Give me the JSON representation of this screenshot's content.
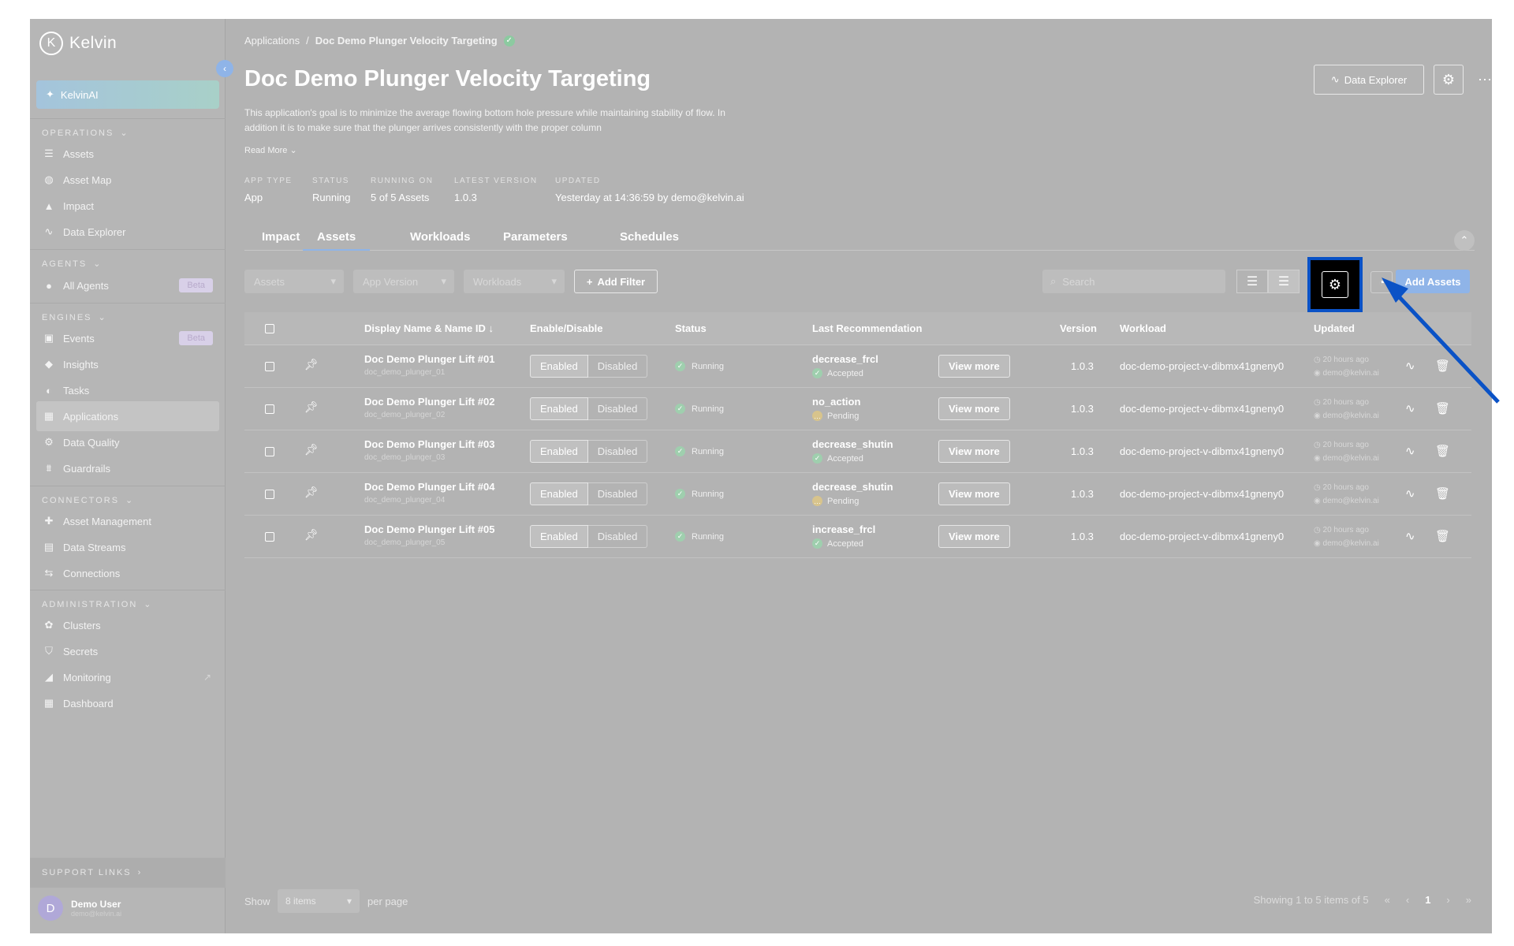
{
  "app": {
    "logo_text": "Kelvin",
    "logo_letter": "K"
  },
  "sidebar": {
    "kelvinai_label": "KelvinAI",
    "sections": {
      "operations": "OPERATIONS",
      "agents": "AGENTS",
      "engines": "ENGINES",
      "connectors": "CONNECTORS",
      "administration": "ADMINISTRATION",
      "support": "SUPPORT LINKS"
    },
    "items": {
      "assets": "Assets",
      "asset_map": "Asset Map",
      "impact": "Impact",
      "data_explorer": "Data Explorer",
      "all_agents": "All Agents",
      "events": "Events",
      "insights": "Insights",
      "tasks": "Tasks",
      "applications": "Applications",
      "data_quality": "Data Quality",
      "guardrails": "Guardrails",
      "asset_management": "Asset Management",
      "data_streams": "Data Streams",
      "connections": "Connections",
      "clusters": "Clusters",
      "secrets": "Secrets",
      "monitoring": "Monitoring",
      "dashboard": "Dashboard"
    },
    "beta": "Beta",
    "user": {
      "initial": "D",
      "name": "Demo User",
      "email": "demo@kelvin.ai"
    }
  },
  "header": {
    "breadcrumb_root": "Applications",
    "breadcrumb_sep": "/",
    "breadcrumb_current": "Doc Demo Plunger Velocity Targeting",
    "title": "Doc Demo Plunger Velocity Targeting",
    "description": "This application's goal is to minimize the average flowing bottom hole pressure while maintaining stability of flow. In addition it is to make sure that the plunger arrives consistently with the proper column",
    "read_more": "Read More",
    "data_explorer_btn": "Data Explorer"
  },
  "meta": [
    {
      "label": "APP TYPE",
      "value": "App"
    },
    {
      "label": "STATUS",
      "value": "Running"
    },
    {
      "label": "RUNNING ON",
      "value": "5 of 5 Assets"
    },
    {
      "label": "LATEST VERSION",
      "value": "1.0.3"
    },
    {
      "label": "UPDATED",
      "value": "Yesterday at 14:36:59 by demo@kelvin.ai"
    }
  ],
  "tabs": [
    "Impact",
    "Assets",
    "Workloads",
    "Parameters",
    "Schedules"
  ],
  "toolbar": {
    "filter_assets": "Assets",
    "filter_app_version": "App Version",
    "filter_workloads": "Workloads",
    "add_filter": "Add Filter",
    "search_placeholder": "Search",
    "add_assets": "Add Assets"
  },
  "table": {
    "columns": {
      "name": "Display Name & Name ID",
      "enable": "Enable/Disable",
      "status": "Status",
      "last_rec": "Last Recommendation",
      "version": "Version",
      "workload": "Workload",
      "updated": "Updated"
    },
    "enabled_label": "Enabled",
    "disabled_label": "Disabled",
    "view_more": "View more",
    "rows": [
      {
        "name": "Doc Demo Plunger Lift #01",
        "id": "doc_demo_plunger_01",
        "status": "Running",
        "rec": "decrease_frcl",
        "rec_status": "Accepted",
        "version": "1.0.3",
        "workload": "doc-demo-project-v-dibmx41gneny0",
        "updated": "20 hours ago",
        "by": "demo@kelvin.ai"
      },
      {
        "name": "Doc Demo Plunger Lift #02",
        "id": "doc_demo_plunger_02",
        "status": "Running",
        "rec": "no_action",
        "rec_status": "Pending",
        "version": "1.0.3",
        "workload": "doc-demo-project-v-dibmx41gneny0",
        "updated": "20 hours ago",
        "by": "demo@kelvin.ai"
      },
      {
        "name": "Doc Demo Plunger Lift #03",
        "id": "doc_demo_plunger_03",
        "status": "Running",
        "rec": "decrease_shutin",
        "rec_status": "Accepted",
        "version": "1.0.3",
        "workload": "doc-demo-project-v-dibmx41gneny0",
        "updated": "20 hours ago",
        "by": "demo@kelvin.ai"
      },
      {
        "name": "Doc Demo Plunger Lift #04",
        "id": "doc_demo_plunger_04",
        "status": "Running",
        "rec": "decrease_shutin",
        "rec_status": "Pending",
        "version": "1.0.3",
        "workload": "doc-demo-project-v-dibmx41gneny0",
        "updated": "20 hours ago",
        "by": "demo@kelvin.ai"
      },
      {
        "name": "Doc Demo Plunger Lift #05",
        "id": "doc_demo_plunger_05",
        "status": "Running",
        "rec": "increase_frcl",
        "rec_status": "Accepted",
        "version": "1.0.3",
        "workload": "doc-demo-project-v-dibmx41gneny0",
        "updated": "20 hours ago",
        "by": "demo@kelvin.ai"
      }
    ]
  },
  "footer": {
    "show": "Show",
    "per_page_value": "8 items",
    "per_page": "per page",
    "showing": "Showing 1 to 5 items of 5",
    "current_page": "1"
  },
  "colors": {
    "overlay": "#b3b3b3",
    "accent": "#8fb4e8",
    "highlight_border": "#0a52c6",
    "arrow": "#0a52c6"
  }
}
